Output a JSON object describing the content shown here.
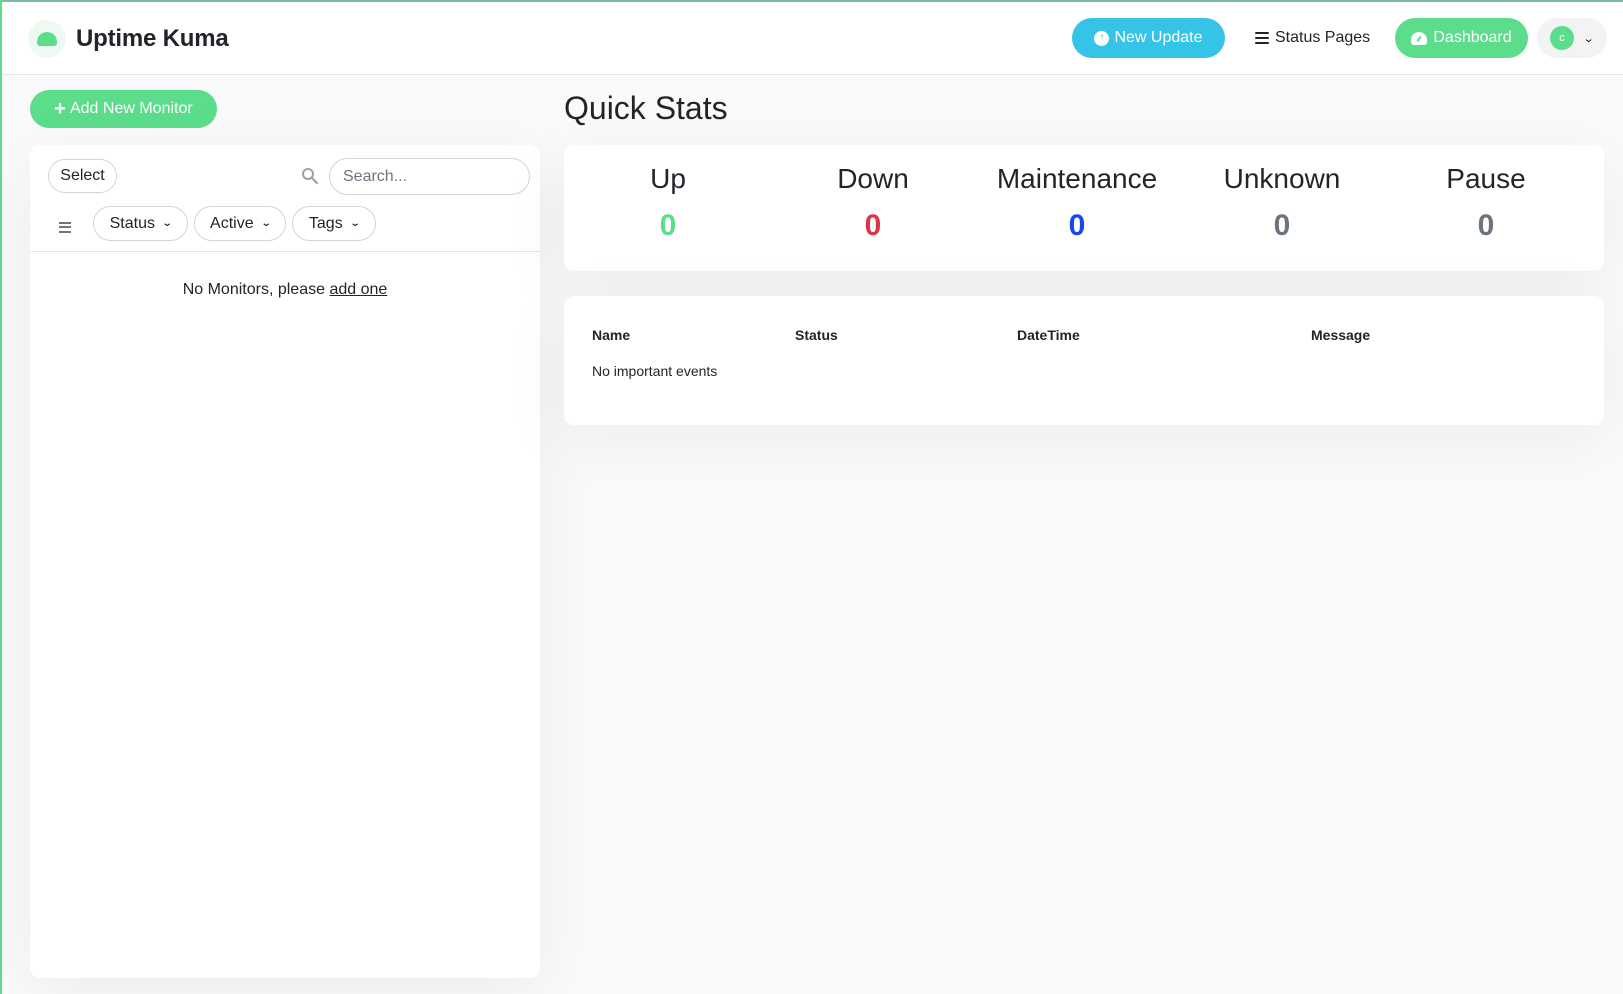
{
  "header": {
    "app_name": "Uptime Kuma",
    "new_update_label": "New Update",
    "status_pages_label": "Status Pages",
    "dashboard_label": "Dashboard",
    "avatar_initial": "c"
  },
  "sidebar": {
    "add_monitor_label": "Add New Monitor",
    "select_label": "Select",
    "search_placeholder": "Search...",
    "filters": [
      "Status",
      "Active",
      "Tags"
    ],
    "empty_text": "No Monitors, please",
    "empty_link": "add one"
  },
  "quick_stats": {
    "title": "Quick Stats",
    "items": [
      {
        "label": "Up",
        "value": "0",
        "color": "#5cdd8b"
      },
      {
        "label": "Down",
        "value": "0",
        "color": "#dc3545"
      },
      {
        "label": "Maintenance",
        "value": "0",
        "color": "#1747f5"
      },
      {
        "label": "Unknown",
        "value": "0",
        "color": "#6c757d"
      },
      {
        "label": "Pause",
        "value": "0",
        "color": "#6c757d"
      }
    ]
  },
  "events": {
    "columns": [
      "Name",
      "Status",
      "DateTime",
      "Message"
    ],
    "empty_text": "No important events"
  },
  "colors": {
    "primary": "#5cdd8b",
    "info": "#35c3e8"
  }
}
